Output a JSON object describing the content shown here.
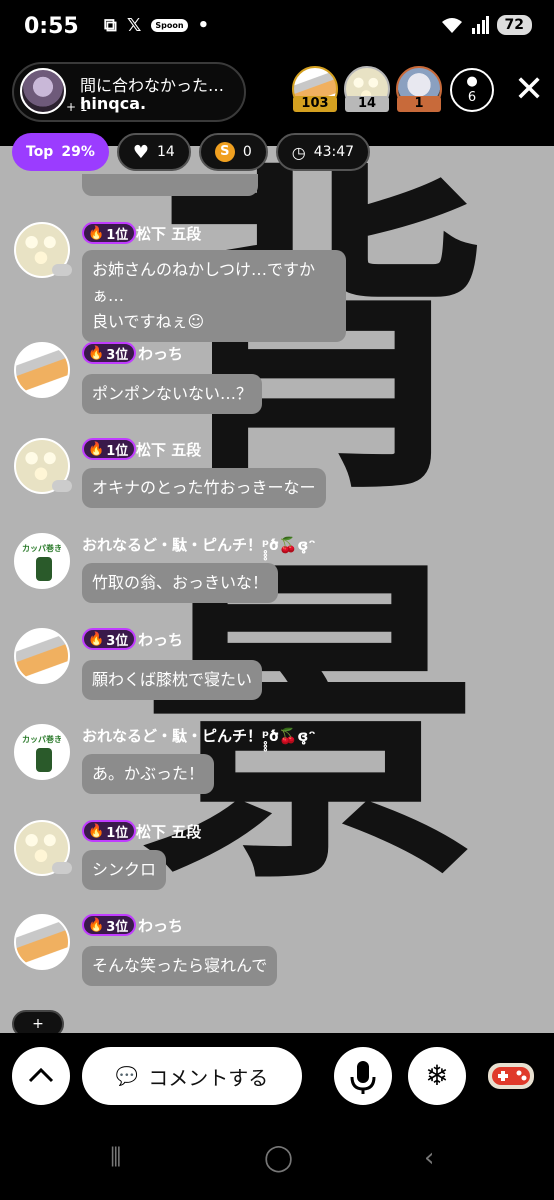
{
  "status": {
    "time": "0:55",
    "left_icons": [
      "screenshot-icon",
      "x-icon",
      "spoon-icon"
    ],
    "spoon_label": "Spoon",
    "dot": "•",
    "wifi_sub": "6",
    "battery": "72"
  },
  "header": {
    "host_title": "間に合わなかった…",
    "host_name": "hinqca.",
    "host_plus": "+ 1",
    "ranks": [
      {
        "count": "103",
        "color": "#d4a020"
      },
      {
        "count": "14",
        "color": "#b8b8b8"
      },
      {
        "count": "1",
        "color": "#c86a3a"
      }
    ],
    "viewers": "6"
  },
  "pills": {
    "top_label": "Top",
    "top_pct": "29%",
    "likes": "14",
    "coins": "0",
    "coin_symbol": "S",
    "time": "43:47"
  },
  "background_chars": [
    "背",
    "景"
  ],
  "messages": [
    {
      "rank": "1位",
      "name": "松下 五段",
      "text": [
        "お姉さんのねかしつけ…ですかぁ…",
        "良いですねぇ☺"
      ]
    },
    {
      "rank": "3位",
      "name": "わっち",
      "text": [
        "ポンポンないない…？"
      ]
    },
    {
      "rank": "1位",
      "name": "松下 五段",
      "text": [
        "オキナのとった竹おっきーなー"
      ]
    },
    {
      "rank": "",
      "name": "おれなるど・駄・ピんチ！ᵖ̥̥̥ծ🍒ɞ̥̥̥ᵔ",
      "text": [
        "竹取の翁、おっきいな！"
      ],
      "avatar_label": "カッパ巻き"
    },
    {
      "rank": "3位",
      "name": "わっち",
      "text": [
        "願わくば膝枕で寝たい"
      ]
    },
    {
      "rank": "",
      "name": "おれなるど・駄・ピんチ！ᵖ̥̥̥ծ🍒ɞ̥̥̥ᵔ",
      "text": [
        "あ。かぶった！"
      ],
      "avatar_label": "カッパ巻き"
    },
    {
      "rank": "1位",
      "name": "松下 五段",
      "text": [
        "シンクロ"
      ]
    },
    {
      "rank": "3位",
      "name": "わっち",
      "text": [
        "そんな笑ったら寝れんで"
      ]
    }
  ],
  "small_plus": "+",
  "bottom": {
    "comment_label": "コメントする"
  }
}
